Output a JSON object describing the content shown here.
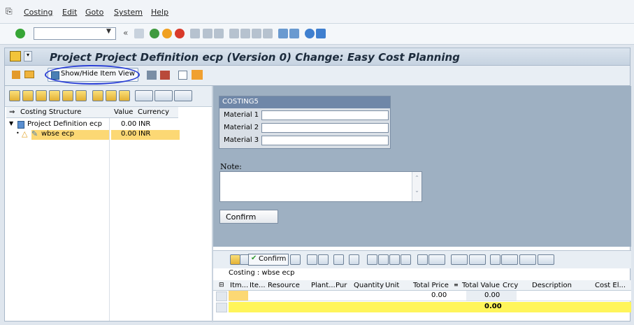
{
  "menu": {
    "items": [
      {
        "label": "Costing",
        "x_hint": "costing"
      },
      {
        "label": "Edit",
        "x_hint": "edit"
      },
      {
        "label": "Goto",
        "x_hint": "goto"
      },
      {
        "label": "System",
        "x_hint": "system"
      },
      {
        "label": "Help",
        "x_hint": "help"
      }
    ]
  },
  "toolbar": {
    "command_value": "",
    "back_symbol": "«"
  },
  "title": "Project Project Definition ecp (Version 0) Change: Easy Cost Planning",
  "app_toolbar": {
    "show_hide_label": "Show/Hide Item View"
  },
  "tree": {
    "col_structure": "Costing Structure",
    "col_value": "Value",
    "col_currency": "Currency",
    "rows": [
      {
        "label": "Project Definition ecp",
        "value": "0.00",
        "currency": "INR"
      },
      {
        "label": "wbse ecp",
        "value": "0.00",
        "currency": "INR"
      }
    ]
  },
  "costing_form": {
    "header": "COSTING5",
    "fields": [
      {
        "label": "Material 1",
        "value": ""
      },
      {
        "label": "Material 2",
        "value": ""
      },
      {
        "label": "Material 3",
        "value": ""
      }
    ],
    "note_label": "Note:",
    "note_value": "",
    "confirm_label": "Confirm"
  },
  "grid": {
    "confirm_label": "Confirm",
    "caption": "Costing : wbse ecp",
    "columns": [
      "Itm...",
      "Ite...",
      "Resource",
      "Plant...",
      "Pur",
      "Quantity",
      "Unit",
      "Total Price",
      "Total Value",
      "Crcy",
      "Description",
      "Cost El..."
    ],
    "row1_total_price": "0.00",
    "row1_total_value": "0.00",
    "total_row_value": "0.00"
  },
  "colors": {
    "title_text": "#1c2b3c",
    "selected_tree_row": "#fcd874",
    "total_row": "#fff55a",
    "form_header": "#6f87a8",
    "annotation_circle": "#2a3fd6"
  }
}
